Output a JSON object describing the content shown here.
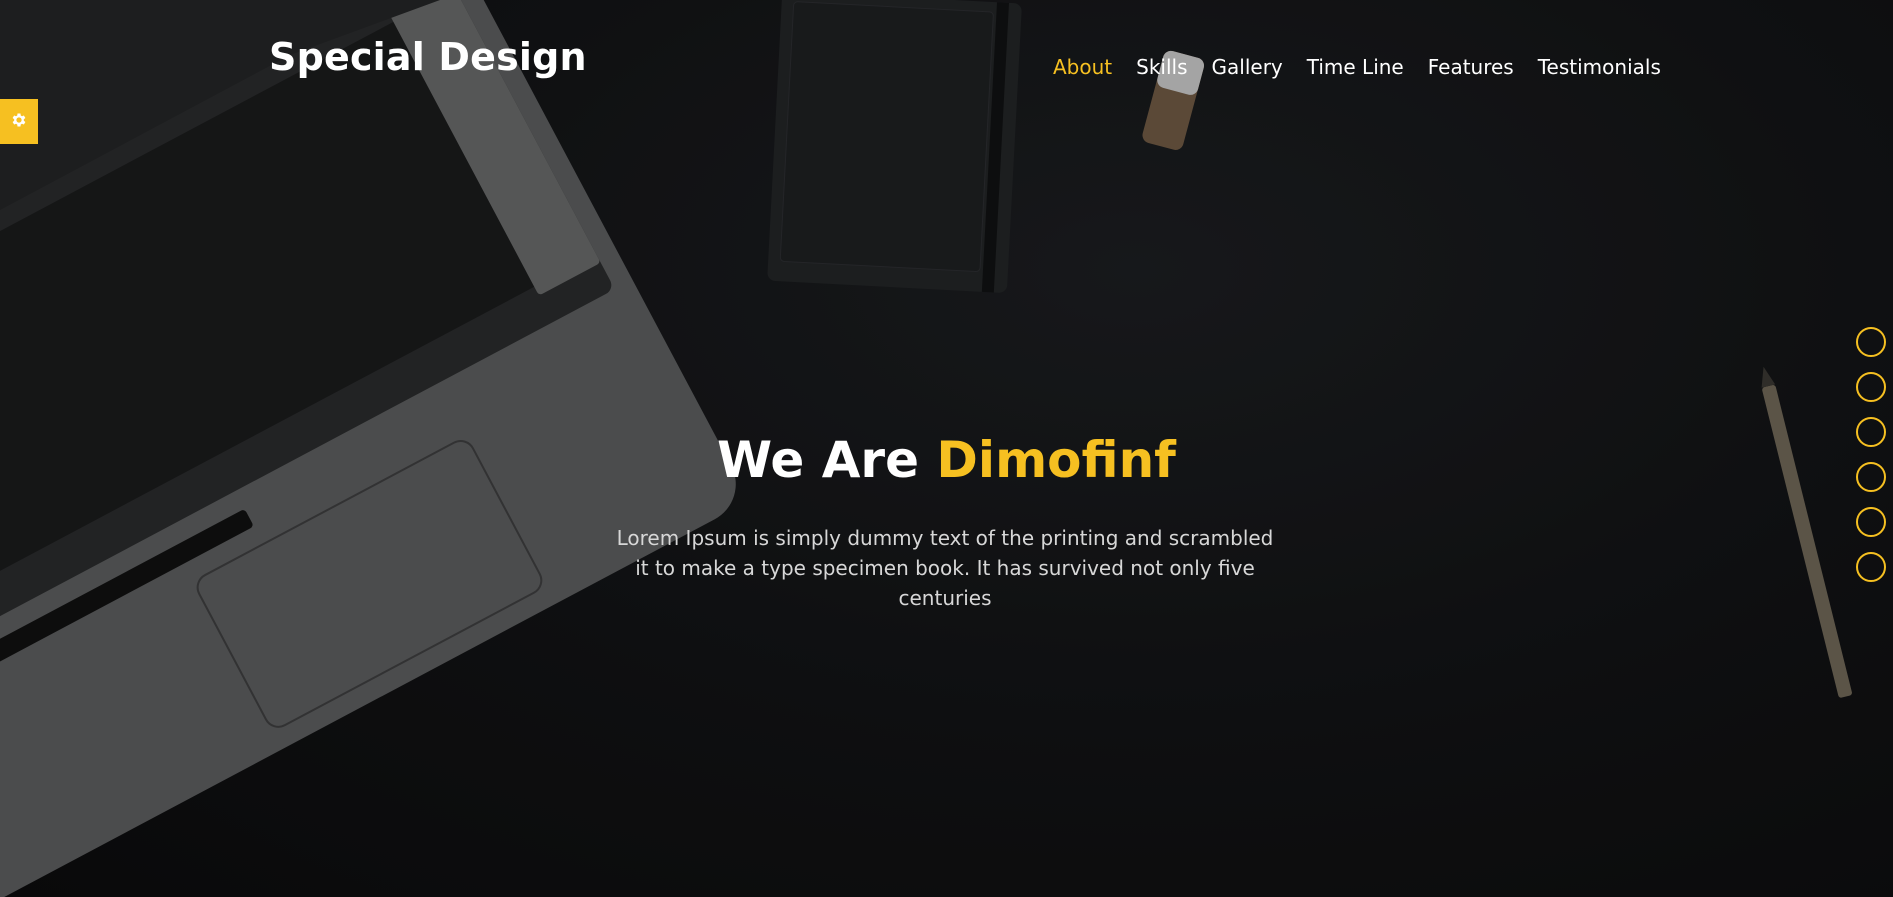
{
  "header": {
    "logo": "Special Design",
    "nav": [
      {
        "label": "About",
        "active": true
      },
      {
        "label": "Skills",
        "active": false
      },
      {
        "label": "Gallery",
        "active": false
      },
      {
        "label": "Time Line",
        "active": false
      },
      {
        "label": "Features",
        "active": false
      },
      {
        "label": "Testimonials",
        "active": false
      }
    ]
  },
  "settings": {
    "icon": "gear-icon"
  },
  "hero": {
    "title_prefix": "We Are",
    "title_accent": "Dimofinf",
    "description": "Lorem Ipsum is simply dummy text of the printing and scrambled it to make a type specimen book. It has survived not only five centuries"
  },
  "bullets": {
    "count": 6,
    "icon": "circle-outline-icon"
  },
  "colors": {
    "accent": "#f6c021",
    "background": "#101112",
    "text": "#ffffff"
  }
}
